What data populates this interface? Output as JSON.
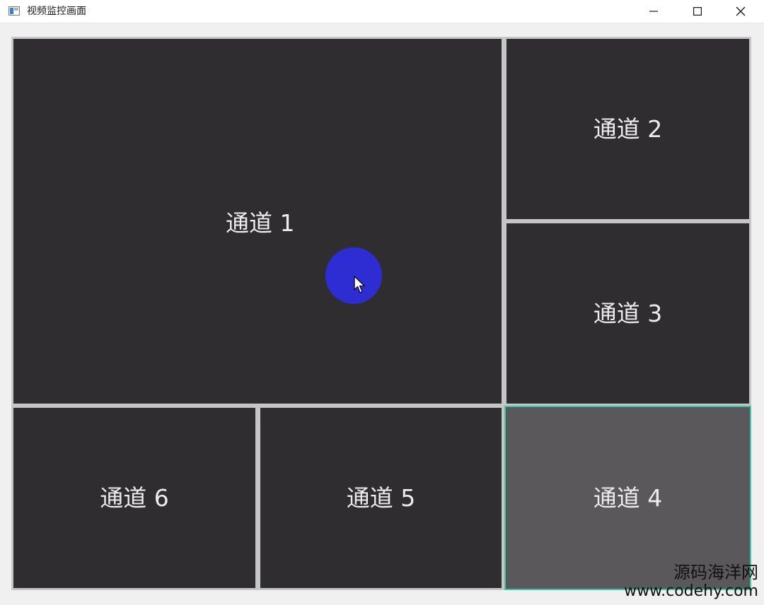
{
  "window": {
    "title": "视频监控画面",
    "buttons": {
      "minimize": "minimize-icon",
      "maximize": "maximize-icon",
      "close": "close-icon"
    }
  },
  "channels": [
    {
      "label": "通道 1",
      "selected": false
    },
    {
      "label": "通道 2",
      "selected": false
    },
    {
      "label": "通道 3",
      "selected": false
    },
    {
      "label": "通道 4",
      "selected": true
    },
    {
      "label": "通道 5",
      "selected": false
    },
    {
      "label": "通道 6",
      "selected": false
    }
  ],
  "watermark": {
    "name": "源码海洋网",
    "url": "www.codehy.com"
  },
  "colors": {
    "panel": "#2f2d30",
    "panel_selected": "#5a585b",
    "selected_border": "#39c7a8",
    "cursor_halo": "#2e2dd4"
  }
}
